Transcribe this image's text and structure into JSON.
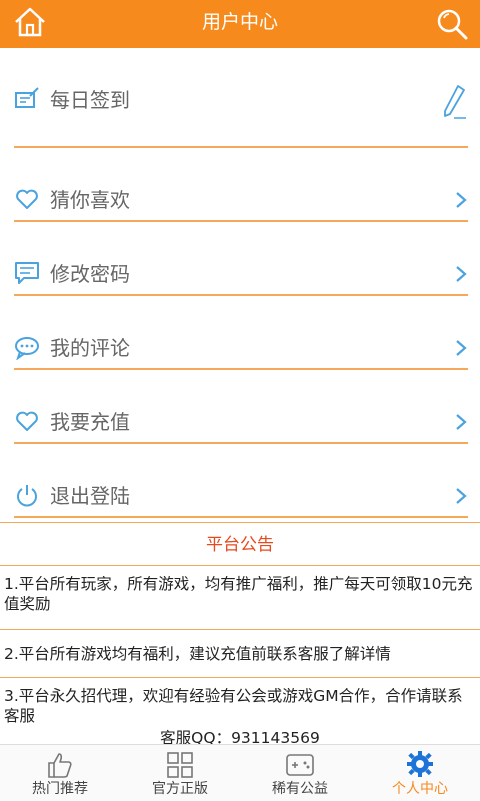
{
  "header": {
    "title": "用户中心",
    "home_icon": "home-icon",
    "search_icon": "search-icon"
  },
  "menu": [
    {
      "label": "每日签到",
      "icon": "checkin-icon",
      "action_icon": "pencil-icon"
    },
    {
      "label": "猜你喜欢",
      "icon": "heart-icon"
    },
    {
      "label": "修改密码",
      "icon": "message-edit-icon"
    },
    {
      "label": "我的评论",
      "icon": "comment-icon"
    },
    {
      "label": "我要充值",
      "icon": "heart-icon"
    },
    {
      "label": "退出登陆",
      "icon": "power-icon"
    }
  ],
  "notice": {
    "title": "平台公告",
    "items": [
      "1.平台所有玩家，所有游戏，均有推广福利，推广每天可领取10元充值奖励",
      "2.平台所有游戏均有福利，建议充值前联系客服了解详情",
      "3.平台永久招代理，欢迎有经验有公会或游戏GM合作，合作请联系客服"
    ],
    "qq": "客服QQ：931143569"
  },
  "tabs": [
    {
      "label": "热门推荐",
      "icon": "thumbs-up-icon"
    },
    {
      "label": "官方正版",
      "icon": "grid-icon"
    },
    {
      "label": "稀有公益",
      "icon": "gamepad-icon"
    },
    {
      "label": "个人中心",
      "icon": "gear-icon",
      "active": true
    }
  ],
  "colors": {
    "accent": "#f78a1d",
    "divider": "#f5a85a",
    "notice_title": "#e64a1c",
    "icon_blue": "#4aa3df"
  }
}
